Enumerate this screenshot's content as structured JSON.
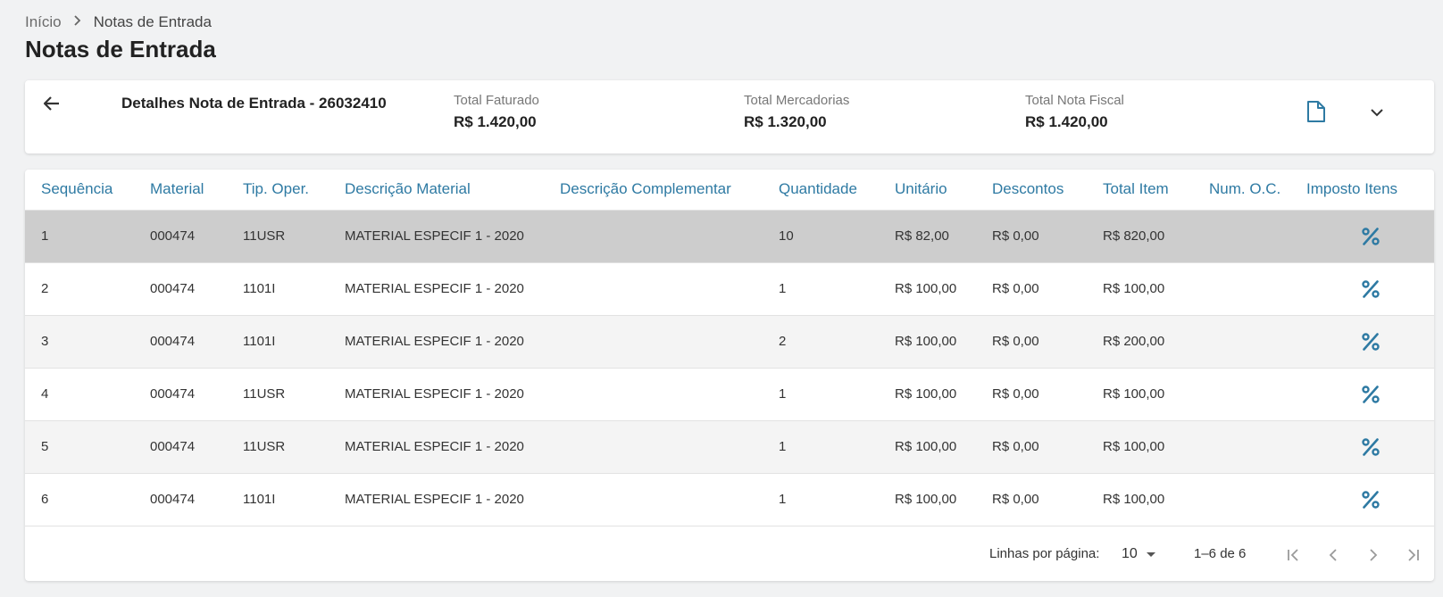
{
  "breadcrumb": {
    "home": "Início",
    "current": "Notas de Entrada"
  },
  "page_title": "Notas de Entrada",
  "detail": {
    "title": "Detalhes Nota de Entrada - 26032410",
    "totals": [
      {
        "label": "Total Faturado",
        "value": "R$ 1.420,00"
      },
      {
        "label": "Total Mercadorias",
        "value": "R$ 1.320,00"
      },
      {
        "label": "Total Nota Fiscal",
        "value": "R$ 1.420,00"
      }
    ]
  },
  "table": {
    "columns": [
      "Sequência",
      "Material",
      "Tip. Oper.",
      "Descrição Material",
      "Descrição Complementar",
      "Quantidade",
      "Unitário",
      "Descontos",
      "Total Item",
      "Num. O.C.",
      "Imposto Itens"
    ],
    "rows": [
      {
        "seq": "1",
        "material": "000474",
        "tip_oper": "11USR",
        "descricao": "MATERIAL ESPECIF 1 - 2020",
        "complementar": "",
        "quantidade": "10",
        "unitario": "R$ 82,00",
        "descontos": "R$ 0,00",
        "total": "R$ 820,00",
        "num_oc": ""
      },
      {
        "seq": "2",
        "material": "000474",
        "tip_oper": "1101I",
        "descricao": "MATERIAL ESPECIF 1 - 2020",
        "complementar": "",
        "quantidade": "1",
        "unitario": "R$ 100,00",
        "descontos": "R$ 0,00",
        "total": "R$ 100,00",
        "num_oc": ""
      },
      {
        "seq": "3",
        "material": "000474",
        "tip_oper": "1101I",
        "descricao": "MATERIAL ESPECIF 1 - 2020",
        "complementar": "",
        "quantidade": "2",
        "unitario": "R$ 100,00",
        "descontos": "R$ 0,00",
        "total": "R$ 200,00",
        "num_oc": ""
      },
      {
        "seq": "4",
        "material": "000474",
        "tip_oper": "11USR",
        "descricao": "MATERIAL ESPECIF 1 - 2020",
        "complementar": "",
        "quantidade": "1",
        "unitario": "R$ 100,00",
        "descontos": "R$ 0,00",
        "total": "R$ 100,00",
        "num_oc": ""
      },
      {
        "seq": "5",
        "material": "000474",
        "tip_oper": "11USR",
        "descricao": "MATERIAL ESPECIF 1 - 2020",
        "complementar": "",
        "quantidade": "1",
        "unitario": "R$ 100,00",
        "descontos": "R$ 0,00",
        "total": "R$ 100,00",
        "num_oc": ""
      },
      {
        "seq": "6",
        "material": "000474",
        "tip_oper": "1101I",
        "descricao": "MATERIAL ESPECIF 1 - 2020",
        "complementar": "",
        "quantidade": "1",
        "unitario": "R$ 100,00",
        "descontos": "R$ 0,00",
        "total": "R$ 100,00",
        "num_oc": ""
      }
    ]
  },
  "paginator": {
    "label": "Linhas por página:",
    "page_size": "10",
    "range": "1–6 de 6"
  },
  "icons": {
    "back": "arrow-left-icon",
    "document": "file-icon",
    "expand": "chevron-down-icon",
    "tax": "percent-icon",
    "first": "first-page-icon",
    "prev": "chevron-left-icon",
    "next": "chevron-right-icon",
    "last": "last-page-icon"
  },
  "colors": {
    "accent": "#2e7aa3",
    "selected_row": "#cdcdcd",
    "striped_row": "#f4f4f4",
    "background": "#f1f2f3"
  }
}
